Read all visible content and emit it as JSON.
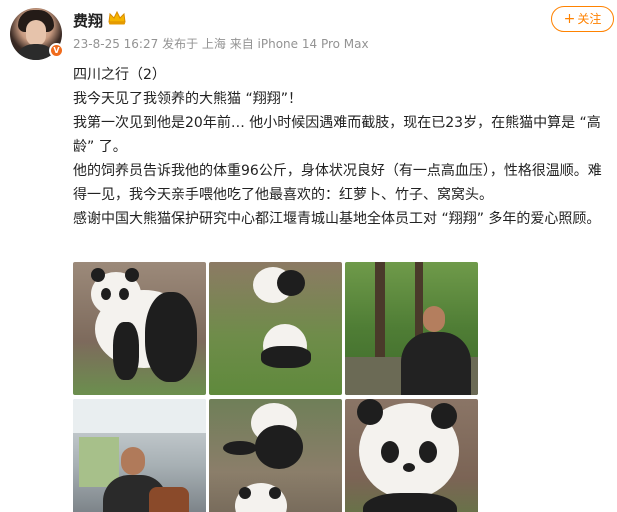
{
  "user": {
    "name": "费翔",
    "verified_badge": "V"
  },
  "meta": {
    "date": "23-8-25 16:27",
    "location": "发布于 上海",
    "source": "来自 iPhone 14 Pro Max"
  },
  "follow_button": {
    "label": "关注",
    "icon": "plus-icon",
    "color": "#ff8200"
  },
  "post": {
    "lines": [
      "四川之行（2）",
      "我今天见了我领养的大熊猫 “翔翔”！",
      "我第一次见到他是20年前… 他小时候因遇难而截肢，现在已23岁，在熊猫中算是 “高龄” 了。",
      "他的饲养员告诉我他的体重96公斤，身体状况良好（有一点高血压），性格很温顺。难得一见，我今天亲手喂他吃了他最喜欢的：红萝卜、竹子、窝窝头。",
      "感谢中国大熊猫保护研究中心都江堰青城山基地全体员工对 “翔翔” 多年的爱心照顾。"
    ]
  },
  "gallery": {
    "images": [
      "panda-walking-photo",
      "panda-on-grass-photo",
      "man-in-forest-photo",
      "man-in-vehicle-photo",
      "panda-sitting-photo",
      "panda-closeup-photo"
    ]
  },
  "colors": {
    "accent": "#ff8200",
    "meta": "#939393",
    "text": "#222222"
  }
}
